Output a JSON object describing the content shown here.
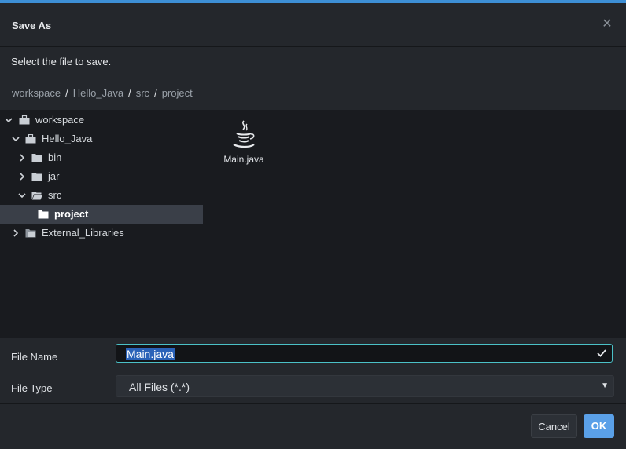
{
  "dialog": {
    "title": "Save As",
    "subtitle": "Select the file to save.",
    "accent_color": "#3d8fd6"
  },
  "breadcrumb": [
    "workspace",
    "Hello_Java",
    "src",
    "project"
  ],
  "tree": [
    {
      "label": "workspace",
      "expanded": true,
      "icon": "briefcase-icon"
    },
    {
      "label": "Hello_Java",
      "expanded": true,
      "icon": "briefcase-icon"
    },
    {
      "label": "bin",
      "expanded": false,
      "icon": "folder-icon"
    },
    {
      "label": "jar",
      "expanded": false,
      "icon": "folder-icon"
    },
    {
      "label": "src",
      "expanded": true,
      "icon": "folder-open-icon"
    },
    {
      "label": "project",
      "selected": true,
      "icon": "folder-icon"
    },
    {
      "label": "External_Libraries",
      "expanded": false,
      "icon": "library-icon"
    }
  ],
  "files": [
    {
      "name": "Main.java",
      "icon": "java-icon"
    }
  ],
  "form": {
    "file_name_label": "File Name",
    "file_name_value": "Main.java",
    "file_type_label": "File Type",
    "file_type_value": "All Files (*.*)"
  },
  "buttons": {
    "cancel": "Cancel",
    "ok": "OK"
  }
}
